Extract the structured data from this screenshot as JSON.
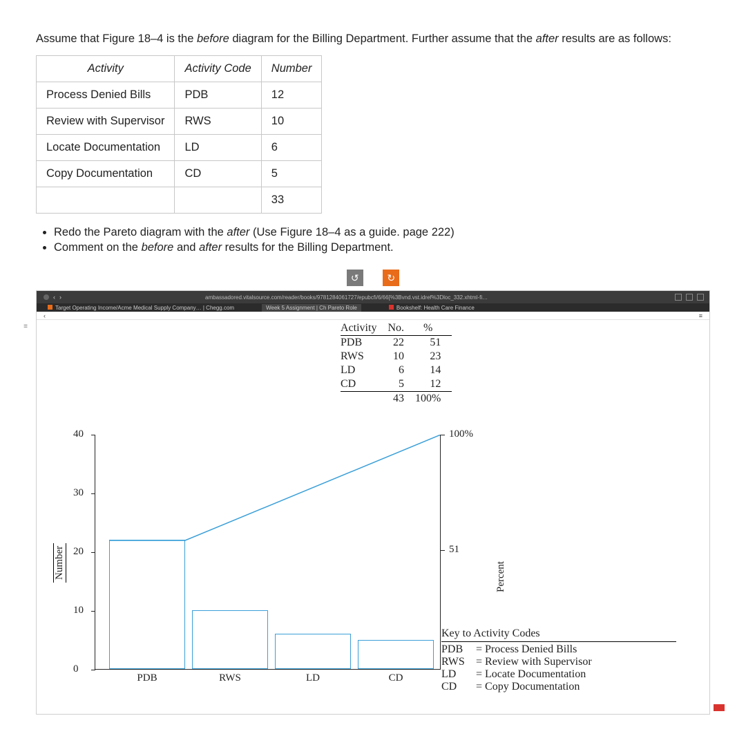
{
  "intro_before": "Assume that Figure 18–4 is the ",
  "intro_word_before": "before",
  "intro_mid": " diagram for the Billing Department. Further assume that the ",
  "intro_word_after": "after",
  "intro_end": " results are as follows:",
  "table_headers": {
    "c1": "Activity",
    "c2": "Activity Code",
    "c3": "Number"
  },
  "after_rows": [
    {
      "activity": "Process Denied Bills",
      "code": "PDB",
      "num": "12"
    },
    {
      "activity": "Review with Supervisor",
      "code": "RWS",
      "num": "10"
    },
    {
      "activity": "Locate Documentation",
      "code": "LD",
      "num": "6"
    },
    {
      "activity": "Copy Documentation",
      "code": "CD",
      "num": "5"
    }
  ],
  "after_total": "33",
  "bullet1_a": "Redo the Pareto diagram with the ",
  "bullet1_b": "after",
  "bullet1_c": " (Use Figure 18–4 as a guide. page 222)",
  "bullet2_a": "Comment on the ",
  "bullet2_b": "before",
  "bullet2_c": " and ",
  "bullet2_d": "after",
  "bullet2_e": " results for the Billing Department.",
  "controls": {
    "undo": "↺",
    "redo": "↻"
  },
  "chrome": {
    "url": "ambassadored.vitalsource.com/reader/books/9781284061727/epubcfi/6/66[%3Bvnd.vst.idref%3Dloc_332.xhtml-fi…",
    "tab1": "Target Operating Income/Acme Medical Supply Company… | Chegg.com",
    "tab2": "Week 5 Assignment | Ch Pareto Role",
    "tab3": "Bookshelf: Health Care Finance",
    "back": "‹",
    "fwd": "›",
    "menu": "≡"
  },
  "mini_table": {
    "h1": "Activity",
    "h2": "No.",
    "h3": "%",
    "rows": [
      {
        "a": "PDB",
        "n": "22",
        "p": "51"
      },
      {
        "a": "RWS",
        "n": "10",
        "p": "23"
      },
      {
        "a": "LD",
        "n": "6",
        "p": "14"
      },
      {
        "a": "CD",
        "n": "5",
        "p": "12"
      }
    ],
    "tot_n": "43",
    "tot_p": "100%"
  },
  "chart_data": {
    "type": "bar",
    "categories": [
      "PDB",
      "RWS",
      "LD",
      "CD"
    ],
    "values": [
      22,
      10,
      6,
      5
    ],
    "cum_percent": [
      51,
      74,
      88,
      100
    ],
    "title": "",
    "xlabel": "",
    "ylabel": "Number",
    "ylim": [
      0,
      40
    ],
    "y_ticks": [
      0,
      10,
      20,
      30,
      40
    ],
    "right_ylabel": "Percent",
    "right_ticks": [
      {
        "v": 51,
        "label": "51"
      },
      {
        "v": 100,
        "label": "100%"
      }
    ],
    "legend_title": "Key to Activity Codes",
    "legend": [
      {
        "code": "PDB",
        "desc": "Process Denied Bills"
      },
      {
        "code": "RWS",
        "desc": "Review with Supervisor"
      },
      {
        "code": "LD",
        "desc": "Locate Documentation"
      },
      {
        "code": "CD",
        "desc": "Copy Documentation"
      }
    ]
  }
}
